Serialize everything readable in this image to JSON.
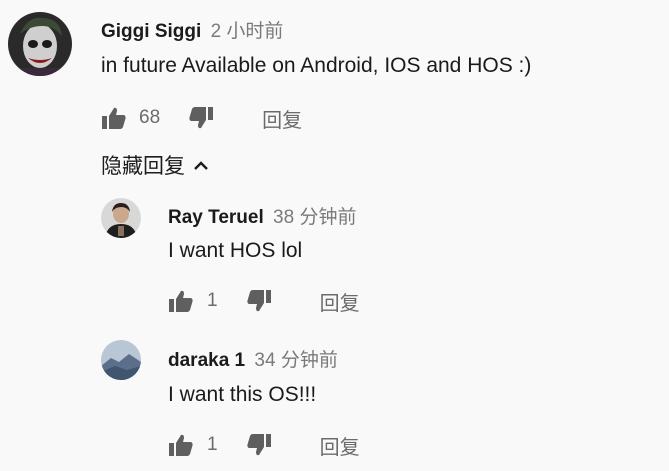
{
  "colors": {
    "background": "#f9f9f9",
    "text": "#1a1a1a",
    "muted": "#6b6b6b",
    "icon": "#5f5f5f"
  },
  "comments": [
    {
      "author": "Giggi Siggi",
      "time": "2 小时前",
      "text": "in future Available on Android, IOS and HOS :)",
      "likes": "68",
      "reply_label": "回复",
      "avatar_icon": "joker-avatar"
    }
  ],
  "hide_replies_label": "隐藏回复",
  "replies": [
    {
      "author": "Ray Teruel",
      "time": "38 分钟前",
      "text": "I want HOS lol",
      "likes": "1",
      "reply_label": "回复",
      "avatar_icon": "person-avatar"
    },
    {
      "author": "daraka 1",
      "time": "34 分钟前",
      "text": "I want this OS!!!",
      "likes": "1",
      "reply_label": "回复",
      "avatar_icon": "landscape-avatar"
    }
  ]
}
